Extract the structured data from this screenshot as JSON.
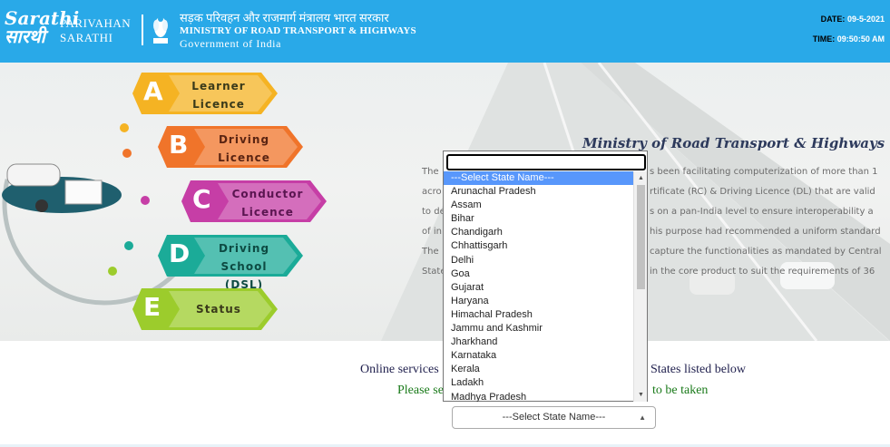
{
  "header": {
    "logo_line1": "Sarathi",
    "logo_line2": "सारथी",
    "brand_line1": "PARIVAHAN",
    "brand_line2": "SARATHI",
    "ministry_hindi": "सड़क परिवहन और राजमार्ग मंत्रालय भारत सरकार",
    "ministry_english": "MINISTRY OF ROAD TRANSPORT & HIGHWAYS",
    "government": "Government of India",
    "date_label": "DATE:",
    "date_value": "09-5-2021",
    "time_label": "TIME:",
    "time_value": "09:50:50 AM"
  },
  "menu": [
    {
      "letter": "A",
      "line1": "Learner",
      "line2": "Licence",
      "color": "#f5b323"
    },
    {
      "letter": "B",
      "line1": "Driving",
      "line2": "Licence",
      "color": "#f0742a"
    },
    {
      "letter": "C",
      "line1": "Conductor",
      "line2": "Licence",
      "color": "#c63ea6"
    },
    {
      "letter": "D",
      "line1": "Driving",
      "line2": "School (DSL)",
      "color": "#1bab98"
    },
    {
      "letter": "E",
      "line1": "Status",
      "line2": "",
      "color": "#9ccc2c"
    }
  ],
  "banner": {
    "title": "Ministry of Road Transport & Highways",
    "left_fragments": [
      "The",
      "acro",
      "to de",
      "of in",
      "The",
      "State"
    ],
    "right_fragments": [
      "s been facilitating computerization of more than 1",
      "rtificate (RC) & Driving Licence (DL) that are valid",
      "s on a pan-India level to ensure interoperability a",
      "his purpose had recommended a uniform standard",
      "capture the functionalities as mandated by Central",
      "in the core product to suit the requirements of 36"
    ]
  },
  "intro": {
    "online_left": "Online services",
    "online_right": "States listed below",
    "please_left": "Please se",
    "please_right": "to be taken"
  },
  "state_select": {
    "selected": "---Select State Name---",
    "search_value": "",
    "options": [
      "---Select State Name---",
      "Arunachal Pradesh",
      "Assam",
      "Bihar",
      "Chandigarh",
      "Chhattisgarh",
      "Delhi",
      "Goa",
      "Gujarat",
      "Haryana",
      "Himachal Pradesh",
      "Jammu and Kashmir",
      "Jharkhand",
      "Karnataka",
      "Kerala",
      "Ladakh",
      "Madhya Pradesh"
    ]
  },
  "colors": {
    "header_bg": "#29a9e8",
    "highlight": "#5897fb",
    "intro_text": "#1f1f4d",
    "please_text": "#1a7a1a"
  }
}
